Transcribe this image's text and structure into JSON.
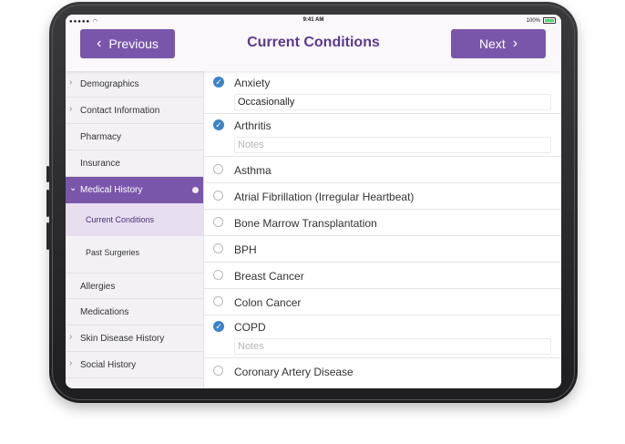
{
  "status": {
    "time": "9:41 AM",
    "battery": "100%"
  },
  "nav": {
    "previous_label": "Previous",
    "title": "Current Conditions",
    "next_label": "Next"
  },
  "sidebar": {
    "items": [
      {
        "label": "Demographics",
        "expandable": true
      },
      {
        "label": "Contact Information",
        "expandable": true
      },
      {
        "label": "Pharmacy",
        "expandable": false
      },
      {
        "label": "Insurance",
        "expandable": false
      },
      {
        "label": "Medical History",
        "expandable": true,
        "active": true
      },
      {
        "label": "Allergies",
        "expandable": false
      },
      {
        "label": "Medications",
        "expandable": false
      },
      {
        "label": "Skin Disease History",
        "expandable": true
      },
      {
        "label": "Social History",
        "expandable": true
      }
    ],
    "subitems": [
      {
        "label": "Current Conditions",
        "selected": true
      },
      {
        "label": "Past Surgeries",
        "selected": false
      }
    ]
  },
  "conditions": [
    {
      "label": "Anxiety",
      "checked": true,
      "notes_value": "Occasionally",
      "notes_placeholder": ""
    },
    {
      "label": "Arthritis",
      "checked": true,
      "notes_value": "",
      "notes_placeholder": "Notes"
    },
    {
      "label": "Asthma",
      "checked": false
    },
    {
      "label": "Atrial Fibrillation (Irregular Heartbeat)",
      "checked": false
    },
    {
      "label": "Bone Marrow Transplantation",
      "checked": false
    },
    {
      "label": "BPH",
      "checked": false
    },
    {
      "label": "Breast Cancer",
      "checked": false
    },
    {
      "label": "Colon Cancer",
      "checked": false
    },
    {
      "label": "COPD",
      "checked": true,
      "notes_value": "",
      "notes_placeholder": "Notes"
    },
    {
      "label": "Coronary Artery Disease",
      "checked": false
    }
  ],
  "colors": {
    "accent": "#7a56ab",
    "check": "#3d82c6",
    "title": "#5a3a8e"
  }
}
